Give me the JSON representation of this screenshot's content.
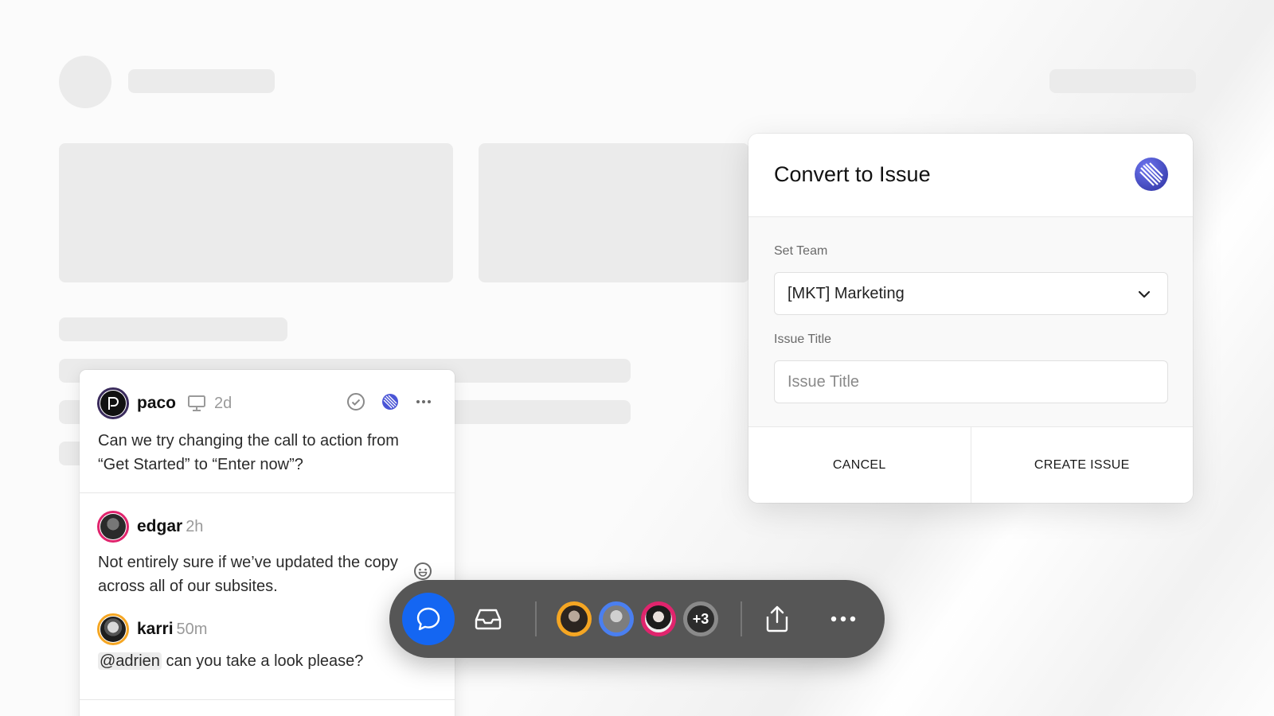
{
  "comments": [
    {
      "name": "paco",
      "time": "2d",
      "text": "Can we try changing the call to action from “Get Started” to “Enter now”?",
      "ring_color": "#3a2b5c"
    },
    {
      "name": "edgar",
      "time": "2h",
      "text": "Not entirely sure if we’ve updated the copy across all of our subsites.",
      "ring_color": "#e0246d"
    },
    {
      "name": "karri",
      "time": "50m",
      "mention": "@adrien",
      "text": " can you take a look please?",
      "ring_color": "#f5a623"
    }
  ],
  "toolbar": {
    "more_count": "+3",
    "accent_color": "#1466f2",
    "icons": [
      "chat-bubble-icon",
      "inbox-icon",
      "share-icon",
      "more-horizontal-icon"
    ],
    "avatar_ring_colors": [
      "#f5a623",
      "#4a7ff0",
      "#e0246d",
      "#333333"
    ]
  },
  "dialog": {
    "title": "Convert to Issue",
    "team_label": "Set Team",
    "team_value": "[MKT] Marketing",
    "issue_title_label": "Issue Title",
    "issue_title_placeholder": "Issue Title",
    "issue_title_value": "",
    "cancel_label": "CANCEL",
    "create_label": "CREATE ISSUE",
    "logo_color": "#4a55d6"
  }
}
